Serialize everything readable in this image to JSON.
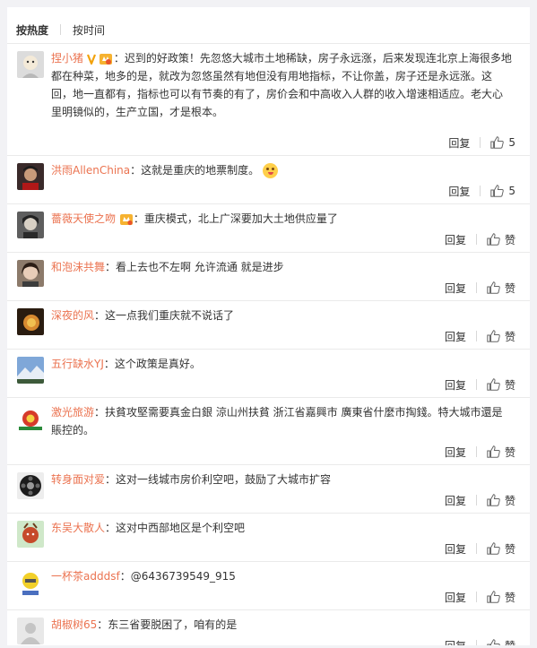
{
  "tabs": [
    "按热度",
    "按时间"
  ],
  "actions": {
    "reply": "回复",
    "like": "赞"
  },
  "comments": [
    {
      "name": "捏小猪",
      "text": "：迟到的好政策！先忽悠大城市土地稀缺，房子永远涨，后来发现连北京上海很多地都在种菜，地多的是，就改为忽悠虽然有地但没有用地指标，不让你盖，房子还是永远涨。这回，地一直都有，指标也可以有节奏的有了，房价会和中高收入人群的收入增速相适应。老大心里明镜似的，生产立国，才是根本。",
      "likes": "5"
    },
    {
      "name": "洪雨AllenChina",
      "text": "：这就是重庆的地票制度。",
      "likes": "5"
    },
    {
      "name": "薔薇天使之吻",
      "text": "：重庆模式，北上广深要加大土地供应量了",
      "likes": "赞"
    },
    {
      "name": "和泡沫共舞",
      "text": "：看上去也不左啊 允许流通 就是进步",
      "likes": "赞"
    },
    {
      "name": "深夜的风",
      "text": "：这一点我们重庆就不说话了",
      "likes": "赞"
    },
    {
      "name": "五行缺水YJ",
      "text": "：这个政策是真好。",
      "likes": "赞"
    },
    {
      "name": "激光旅游",
      "text": "：扶貧攻堅需要真金白銀 涼山州扶貧 浙江省嘉興市 廣東省什麼市掏錢。特大城市還是賬控的。",
      "likes": "赞"
    },
    {
      "name": "转身面对爱",
      "text": "：这对一线城市房价利空吧，鼓励了大城市扩容",
      "likes": "赞"
    },
    {
      "name": "东吴大散人",
      "text": "：这对中西部地区是个利空吧",
      "likes": "赞"
    },
    {
      "name": "一杯茶adddsf",
      "text": "：@6436739549_915",
      "likes": "赞"
    },
    {
      "name": "胡椒树65",
      "text": "：东三省要脱困了，咱有的是",
      "likes": "赞"
    }
  ]
}
